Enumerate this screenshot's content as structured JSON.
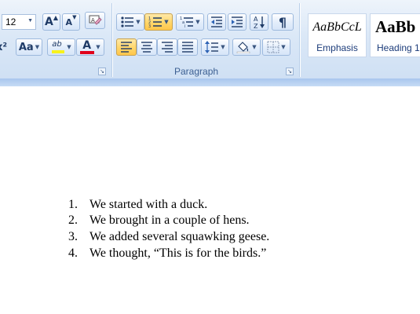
{
  "ribbon": {
    "font": {
      "size_value": "12",
      "grow_font_label": "A",
      "shrink_font_label": "A",
      "change_case_label": "Aa",
      "font_color": "#e0001b",
      "highlight_color": "#f7f21c",
      "highlight_label": "ab"
    },
    "paragraph": {
      "group_label": "Paragraph",
      "pilcrow_label": "¶"
    },
    "styles": {
      "cards": [
        {
          "sample": "AaBbCcL",
          "name": "Emphasis"
        },
        {
          "sample": "AaBb",
          "name": "Heading 1"
        }
      ]
    }
  },
  "document": {
    "list_items": [
      {
        "number": "1.",
        "text": "We started with a duck."
      },
      {
        "number": "2.",
        "text": "We brought in a couple of hens."
      },
      {
        "number": "3.",
        "text": "We added several squawking geese."
      },
      {
        "number": "4.",
        "text": "We thought, “This is for the birds.”"
      }
    ]
  }
}
